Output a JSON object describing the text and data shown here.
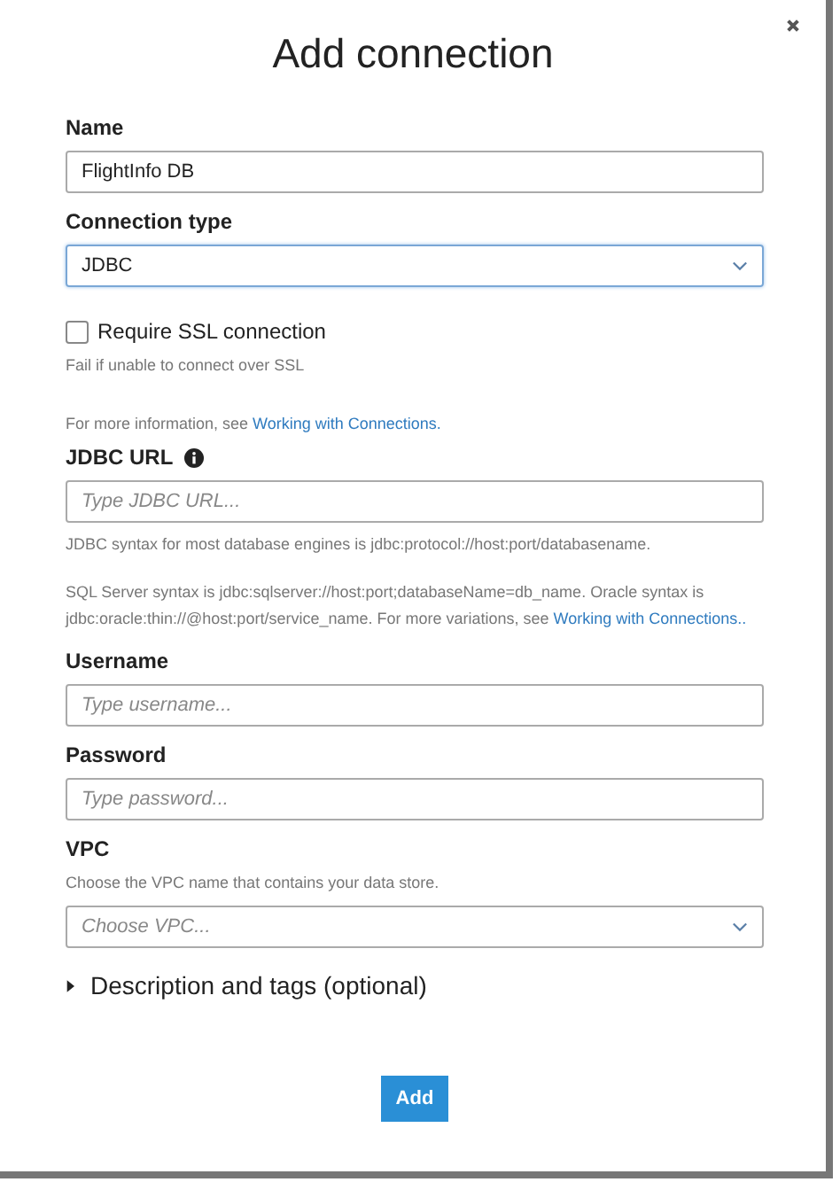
{
  "dialog": {
    "title": "Add connection"
  },
  "fields": [
    {
      "kind": "text",
      "label": "Name",
      "value": "FlightInfo DB"
    },
    {
      "kind": "select",
      "label": "Connection type",
      "value": "JDBC",
      "focused": true
    },
    {
      "kind": "checkbox",
      "label": "Require SSL connection",
      "checked": false,
      "help": "Fail if unable to connect over SSL"
    },
    {
      "kind": "note",
      "text": "For more information, see ",
      "link": "Working with Connections."
    },
    {
      "kind": "text",
      "label": "JDBC URL",
      "info": true,
      "placeholder": "Type JDBC URL...",
      "help": "JDBC syntax for most database engines is jdbc:protocol://host:port/databasename.",
      "note": "SQL Server syntax is jdbc:sqlserver://host:port;databaseName=db_name. Oracle syntax is jdbc:oracle:thin://@host:port/service_name. For more variations, see ",
      "link": "Working with Connections.."
    },
    {
      "kind": "text",
      "label": "Username",
      "placeholder": "Type username..."
    },
    {
      "kind": "text",
      "label": "Password",
      "placeholder": "Type password..."
    },
    {
      "kind": "select",
      "label": "VPC",
      "description": "Choose the VPC name that contains your data store.",
      "placeholder": "Choose VPC...",
      "focused": false
    }
  ],
  "expander": {
    "label": "Description and tags (optional)",
    "expanded": false
  },
  "button": "Add"
}
